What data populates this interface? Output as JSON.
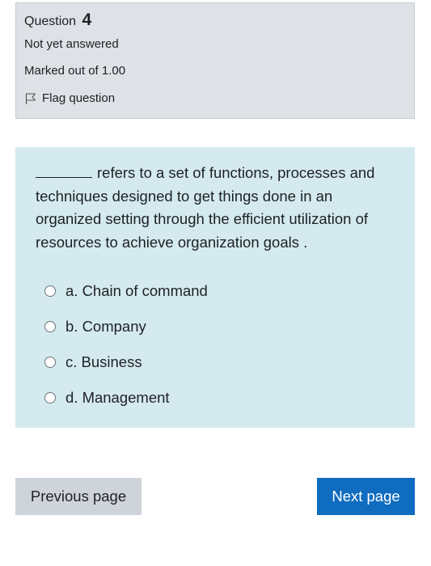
{
  "question_info": {
    "label": "Question",
    "number": "4",
    "state": "Not yet answered",
    "grade": "Marked out of 1.00",
    "flag_label": "Flag question"
  },
  "question": {
    "blank": "_______",
    "text": "refers to a set of functions, processes and techniques designed to get things done in an organized setting through the efficient utilization of resources to achieve organization goals .",
    "options": [
      {
        "label": "a. Chain of command"
      },
      {
        "label": "b. Company"
      },
      {
        "label": "c. Business"
      },
      {
        "label": "d. Management"
      }
    ]
  },
  "nav": {
    "previous_label": "Previous page",
    "next_label": "Next page"
  },
  "colors": {
    "info_bg": "#dee2e6",
    "content_bg": "#d4eaef",
    "prev_bg": "#ced4da",
    "next_bg": "#0f6cbf"
  }
}
